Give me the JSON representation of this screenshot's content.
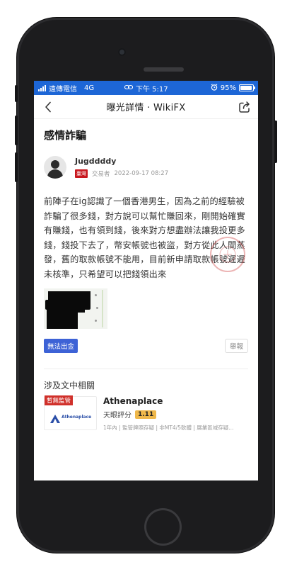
{
  "status_bar": {
    "carrier": "遠傳電信",
    "network": "4G",
    "time": "下午 5:17",
    "battery": "95%",
    "battery_level": 0.95
  },
  "nav": {
    "title": "曝光詳情 · WikiFX"
  },
  "post": {
    "title": "感情詐騙",
    "author": {
      "name": "Jugddddy",
      "region_badge": "臺灣",
      "role": "交易者",
      "date": "2022-09-17 08:27"
    },
    "body": "前陣子在ig認識了一個香港男生，因為之前的經驗被詐騙了很多錢，對方說可以幫忙賺回來，剛開始確實有賺錢，也有領到錢，後來對方想盡辦法讓我投更多錢，錢投下去了，幣安帳號也被盜，對方從此人間蒸發，舊的取款帳號不能用，目前新申請取款帳號遲遲未核準，只希望可以把錢領出來",
    "tag": "無法出金",
    "report_label": "舉報"
  },
  "related": {
    "section_title": "涉及文中相關",
    "broker": {
      "badge": "暫無監管",
      "logo_text": "Athenaplace",
      "name": "Athenaplace",
      "score_label": "天眼評分",
      "score": "1.11",
      "tags": "1年內 | 監管牌照存疑 | 非MT4/5軟體 | 展業區域存疑..."
    }
  },
  "colors": {
    "status_bar": "#1d66d6",
    "tag_blue": "#3d62d6",
    "unregulated_red": "#d0302a",
    "score_gold": "#efb84b"
  }
}
